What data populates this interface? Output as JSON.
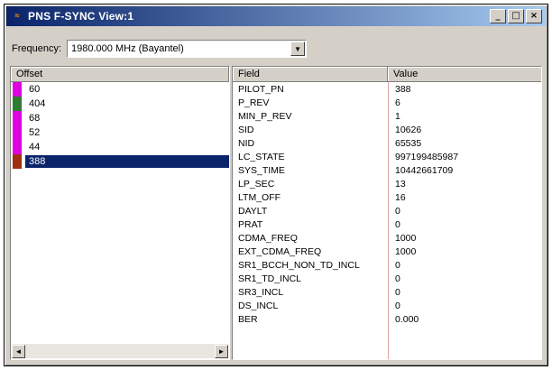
{
  "window": {
    "title": "PNS F-SYNC View:1",
    "icon": "app-icon",
    "controls": {
      "minimize": "_",
      "maximize": "□",
      "close": "×"
    }
  },
  "toolbar": {
    "frequency_label": "Frequency:",
    "frequency_value": "1980.000 MHz (Bayantel)",
    "dropdown_arrow": "▼"
  },
  "offsets": {
    "header": "Offset",
    "rows": [
      {
        "label": "60",
        "color": "#e000e0"
      },
      {
        "label": "404",
        "color": "#2e7d2e"
      },
      {
        "label": "68",
        "color": "#e000e0"
      },
      {
        "label": "52",
        "color": "#e000e0"
      },
      {
        "label": "44",
        "color": "#e000e0"
      },
      {
        "label": "388",
        "color": "#a03010"
      }
    ],
    "selected_index": 5,
    "scroll_left": "◄",
    "scroll_right": "►"
  },
  "fields": {
    "header_field": "Field",
    "header_value": "Value",
    "rows": [
      {
        "field": "PILOT_PN",
        "value": "388"
      },
      {
        "field": "P_REV",
        "value": "6"
      },
      {
        "field": "MIN_P_REV",
        "value": "1"
      },
      {
        "field": "SID",
        "value": "10626"
      },
      {
        "field": "NID",
        "value": "65535"
      },
      {
        "field": "LC_STATE",
        "value": "997199485987"
      },
      {
        "field": "SYS_TIME",
        "value": "10442661709"
      },
      {
        "field": "LP_SEC",
        "value": "13"
      },
      {
        "field": "LTM_OFF",
        "value": "16"
      },
      {
        "field": "DAYLT",
        "value": "0"
      },
      {
        "field": "PRAT",
        "value": "0"
      },
      {
        "field": "CDMA_FREQ",
        "value": "1000"
      },
      {
        "field": "EXT_CDMA_FREQ",
        "value": "1000"
      },
      {
        "field": "SR1_BCCH_NON_TD_INCL",
        "value": "0"
      },
      {
        "field": "SR1_TD_INCL",
        "value": "0"
      },
      {
        "field": "SR3_INCL",
        "value": "0"
      },
      {
        "field": "DS_INCL",
        "value": "0"
      },
      {
        "field": "BER",
        "value": "0.000"
      }
    ]
  }
}
